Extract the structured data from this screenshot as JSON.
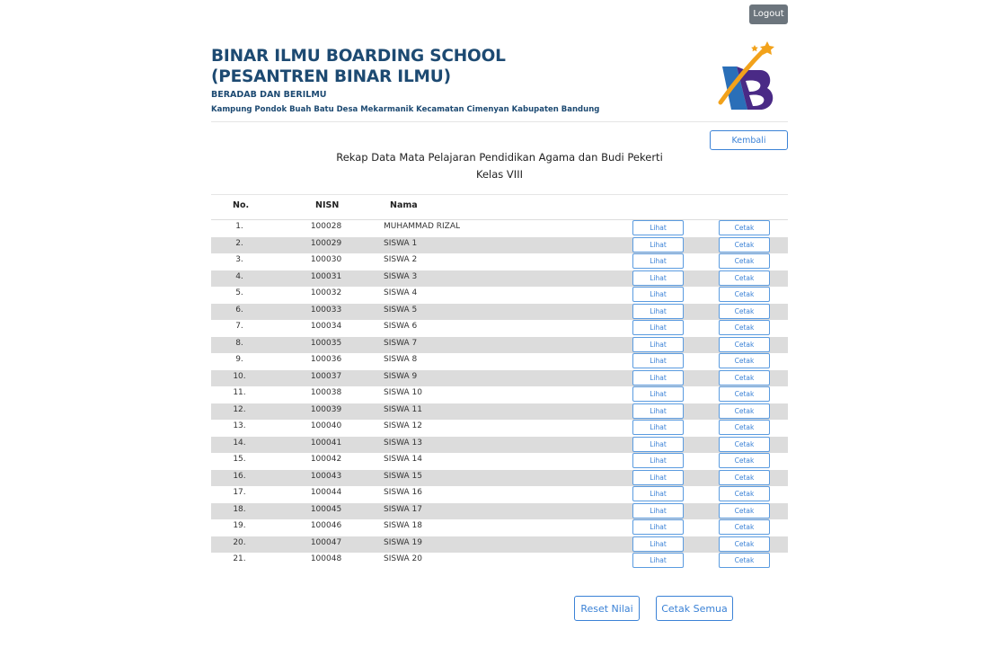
{
  "topbar": {
    "logout_label": "Logout"
  },
  "school": {
    "title_line1": "BINAR ILMU BOARDING SCHOOL",
    "title_line2": "(PESANTREN BINAR ILMU)",
    "tagline": "BERADAB DAN BERILMU",
    "address": "Kampung Pondok Buah Batu Desa Mekarmanik Kecamatan Cimenyan Kabupaten Bandung"
  },
  "back_label": "Kembali",
  "report": {
    "title": "Rekap Data Mata Pelajaran Pendidikan Agama dan Budi Pekerti",
    "class": "Kelas VIII"
  },
  "table": {
    "headers": {
      "no": "No.",
      "nisn": "NISN",
      "nama": "Nama"
    },
    "view_label": "Lihat",
    "print_label": "Cetak",
    "rows": [
      {
        "no": "1.",
        "nisn": "100028",
        "nama": "MUHAMMAD RIZAL"
      },
      {
        "no": "2.",
        "nisn": "100029",
        "nama": "SISWA 1"
      },
      {
        "no": "3.",
        "nisn": "100030",
        "nama": "SISWA 2"
      },
      {
        "no": "4.",
        "nisn": "100031",
        "nama": "SISWA 3"
      },
      {
        "no": "5.",
        "nisn": "100032",
        "nama": "SISWA 4"
      },
      {
        "no": "6.",
        "nisn": "100033",
        "nama": "SISWA 5"
      },
      {
        "no": "7.",
        "nisn": "100034",
        "nama": "SISWA 6"
      },
      {
        "no": "8.",
        "nisn": "100035",
        "nama": "SISWA 7"
      },
      {
        "no": "9.",
        "nisn": "100036",
        "nama": "SISWA 8"
      },
      {
        "no": "10.",
        "nisn": "100037",
        "nama": "SISWA 9"
      },
      {
        "no": "11.",
        "nisn": "100038",
        "nama": "SISWA 10"
      },
      {
        "no": "12.",
        "nisn": "100039",
        "nama": "SISWA 11"
      },
      {
        "no": "13.",
        "nisn": "100040",
        "nama": "SISWA 12"
      },
      {
        "no": "14.",
        "nisn": "100041",
        "nama": "SISWA 13"
      },
      {
        "no": "15.",
        "nisn": "100042",
        "nama": "SISWA 14"
      },
      {
        "no": "16.",
        "nisn": "100043",
        "nama": "SISWA 15"
      },
      {
        "no": "17.",
        "nisn": "100044",
        "nama": "SISWA 16"
      },
      {
        "no": "18.",
        "nisn": "100045",
        "nama": "SISWA 17"
      },
      {
        "no": "19.",
        "nisn": "100046",
        "nama": "SISWA 18"
      },
      {
        "no": "20.",
        "nisn": "100047",
        "nama": "SISWA 19"
      },
      {
        "no": "21.",
        "nisn": "100048",
        "nama": "SISWA 20"
      }
    ]
  },
  "footer": {
    "reset_label": "Reset Nilai",
    "print_all_label": "Cetak Semua"
  },
  "colors": {
    "title": "#1d4a72",
    "accent": "#3b82d6",
    "stripe": "#dcdcdc",
    "logout_bg": "#6c757d"
  }
}
